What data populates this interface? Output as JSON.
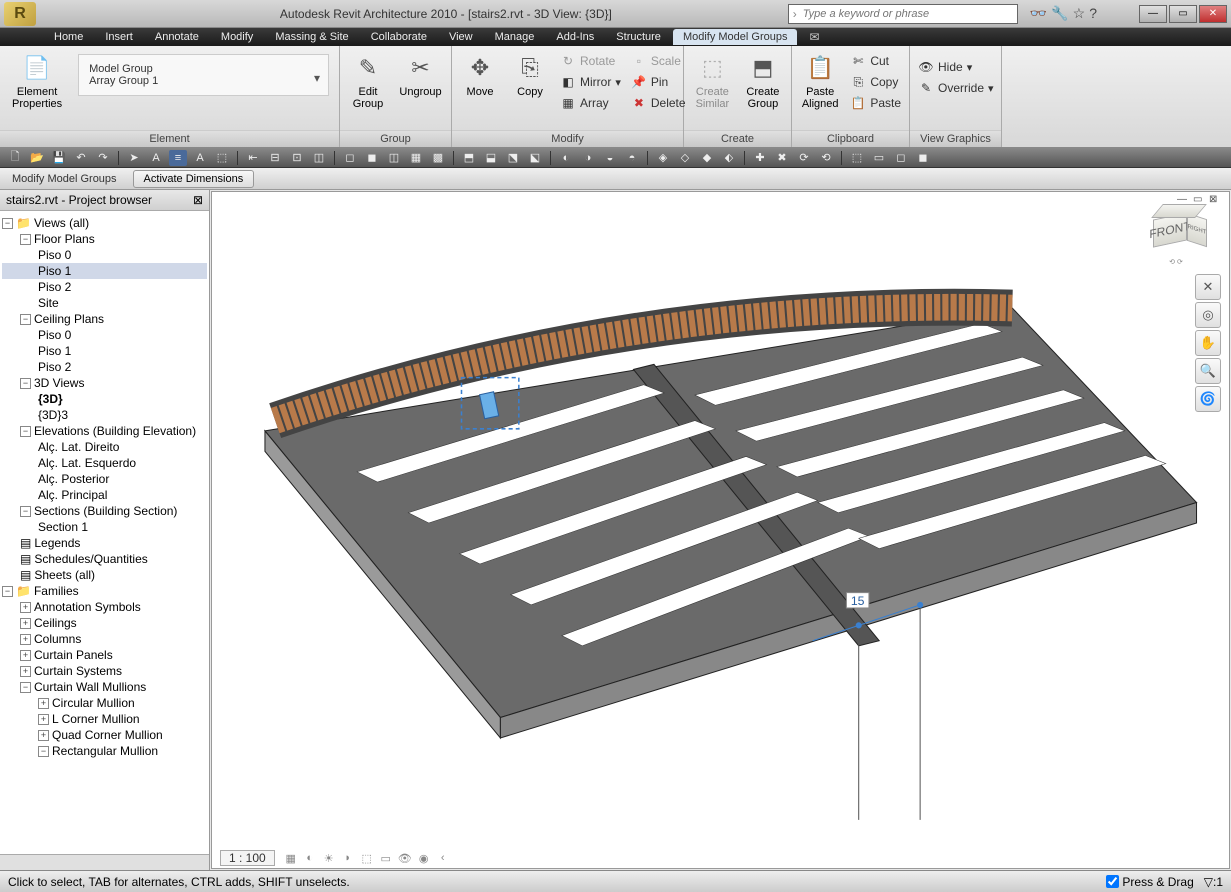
{
  "title": "Autodesk Revit Architecture 2010 - [stairs2.rvt - 3D View: {3D}]",
  "search_placeholder": "Type a keyword or phrase",
  "menubar": [
    "Home",
    "Insert",
    "Annotate",
    "Modify",
    "Massing & Site",
    "Collaborate",
    "View",
    "Manage",
    "Add-Ins",
    "Structure",
    "Modify Model Groups"
  ],
  "menubar_active": 10,
  "ribbon": {
    "element": {
      "label": "Element",
      "props": "Element\nProperties",
      "type_l1": "Model Group",
      "type_l2": "Array Group 1"
    },
    "group": {
      "label": "Group",
      "edit": "Edit\nGroup",
      "ungroup": "Ungroup"
    },
    "modify": {
      "label": "Modify",
      "move": "Move",
      "copy": "Copy",
      "rotate": "Rotate",
      "mirror": "Mirror",
      "array": "Array",
      "scale": "Scale",
      "pin": "Pin",
      "delete": "Delete"
    },
    "create": {
      "label": "Create",
      "similar": "Create\nSimilar",
      "group": "Create\nGroup"
    },
    "clipboard": {
      "label": "Clipboard",
      "paste": "Paste\nAligned",
      "cut": "Cut",
      "copy": "Copy",
      "pastebtn": "Paste"
    },
    "viewgfx": {
      "label": "View Graphics",
      "hide": "Hide",
      "override": "Override"
    }
  },
  "options_bar": {
    "context": "Modify Model Groups",
    "activate": "Activate Dimensions"
  },
  "browser": {
    "title": "stairs2.rvt - Project browser",
    "views": "Views (all)",
    "floorplans": "Floor Plans",
    "fp": [
      "Piso 0",
      "Piso 1",
      "Piso 2",
      "Site"
    ],
    "fp_selected": 1,
    "ceilingplans": "Ceiling Plans",
    "cp": [
      "Piso 0",
      "Piso 1",
      "Piso 2"
    ],
    "views3d": "3D Views",
    "v3": [
      "{3D}",
      "{3D}3"
    ],
    "v3_bold": 0,
    "elevations": "Elevations (Building Elevation)",
    "el": [
      "Alç. Lat. Direito",
      "Alç. Lat. Esquerdo",
      "Alç. Posterior",
      "Alç. Principal"
    ],
    "sections": "Sections (Building Section)",
    "sec": [
      "Section 1"
    ],
    "legends": "Legends",
    "schedules": "Schedules/Quantities",
    "sheets": "Sheets (all)",
    "families": "Families",
    "fam": [
      "Annotation Symbols",
      "Ceilings",
      "Columns",
      "Curtain Panels",
      "Curtain Systems",
      "Curtain Wall Mullions"
    ],
    "mullions": [
      "Circular Mullion",
      "L Corner Mullion",
      "Quad Corner Mullion",
      "Rectangular Mullion"
    ]
  },
  "viewport": {
    "scale": "1 : 100",
    "dim_value": "15"
  },
  "viewcube": {
    "front": "FRONT",
    "right": "RIGHT"
  },
  "statusbar": {
    "hint": "Click to select, TAB for alternates, CTRL adds, SHIFT unselects.",
    "press": "Press & Drag",
    "filter": ":1"
  }
}
